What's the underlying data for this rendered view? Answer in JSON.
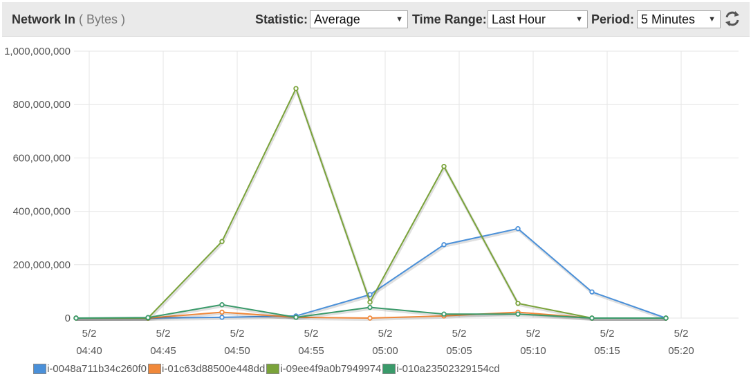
{
  "header": {
    "metric_name": "Network In",
    "metric_unit": "( Bytes )",
    "statistic_label": "Statistic:",
    "statistic_value": "Average",
    "time_range_label": "Time Range:",
    "time_range_value": "Last Hour",
    "period_label": "Period:",
    "period_value": "5 Minutes",
    "refresh_icon": "refresh-icon",
    "dropdown_arrow": "▼"
  },
  "colors": {
    "header_bg": "#eaeaea",
    "grid": "#e6e6e6",
    "series": [
      "#4a90d9",
      "#f0883a",
      "#7aa33a",
      "#3a9a6a"
    ]
  },
  "chart_data": {
    "type": "line",
    "x": [
      "04:40",
      "04:45",
      "04:50",
      "04:55",
      "05:00",
      "05:05",
      "05:10",
      "05:15",
      "05:20"
    ],
    "x_date_labels": [
      "5/2",
      "5/2",
      "5/2",
      "5/2",
      "5/2",
      "5/2",
      "5/2",
      "5/2",
      "5/2"
    ],
    "y_ticks": [
      "0",
      "200,000,000",
      "400,000,000",
      "600,000,000",
      "800,000,000",
      "1,000,000,000"
    ],
    "y_tick_values": [
      0,
      200000000,
      400000000,
      600000000,
      800000000,
      1000000000
    ],
    "ylim": [
      0,
      1000000000
    ],
    "grid": true,
    "legend_position": "bottom-left",
    "point_times": [
      "04:40",
      "04:45",
      "04:50",
      "04:55",
      "05:00",
      "05:05",
      "05:10",
      "05:15",
      "05:20"
    ],
    "series": [
      {
        "name": "i-0048a711b34c260f0",
        "values": [
          0,
          0,
          3000000,
          8000000,
          88000000,
          275000000,
          335000000,
          98000000,
          0
        ]
      },
      {
        "name": "i-01c63d88500e448dd",
        "values": [
          0,
          0,
          22000000,
          3000000,
          0,
          8000000,
          22000000,
          0,
          0
        ]
      },
      {
        "name": "i-09ee4f9a0b7949974",
        "values": [
          0,
          0,
          287000000,
          860000000,
          60000000,
          568000000,
          55000000,
          0,
          0
        ]
      },
      {
        "name": "i-010a23502329154cd",
        "values": [
          0,
          2000000,
          50000000,
          3000000,
          40000000,
          15000000,
          15000000,
          0,
          0
        ]
      }
    ]
  }
}
